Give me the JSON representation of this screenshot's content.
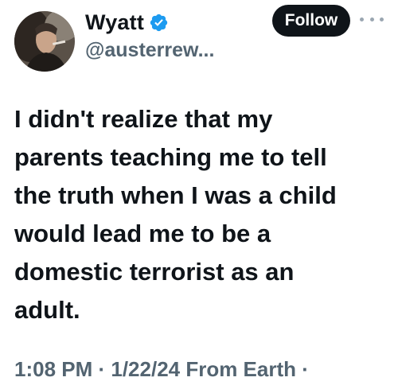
{
  "author": {
    "display_name": "Wyatt",
    "handle": "@austerrew...",
    "verified": true,
    "verified_icon": "verified-badge-icon",
    "avatar": "profile-photo"
  },
  "actions": {
    "follow_label": "Follow",
    "more_icon": "more-options-icon"
  },
  "tweet": {
    "text": "I didn't realize that my\nparents teaching me to tell\nthe truth when I was a child\nwould lead me to be a\ndomestic terrorist as an\nadult.",
    "meta": "1:08 PM · 1/22/24 From Earth ·"
  },
  "colors": {
    "text_primary": "#0f1419",
    "text_secondary": "#536471",
    "verified_blue": "#1d9bf0",
    "follow_bg": "#0f1419",
    "follow_text": "#ffffff"
  }
}
